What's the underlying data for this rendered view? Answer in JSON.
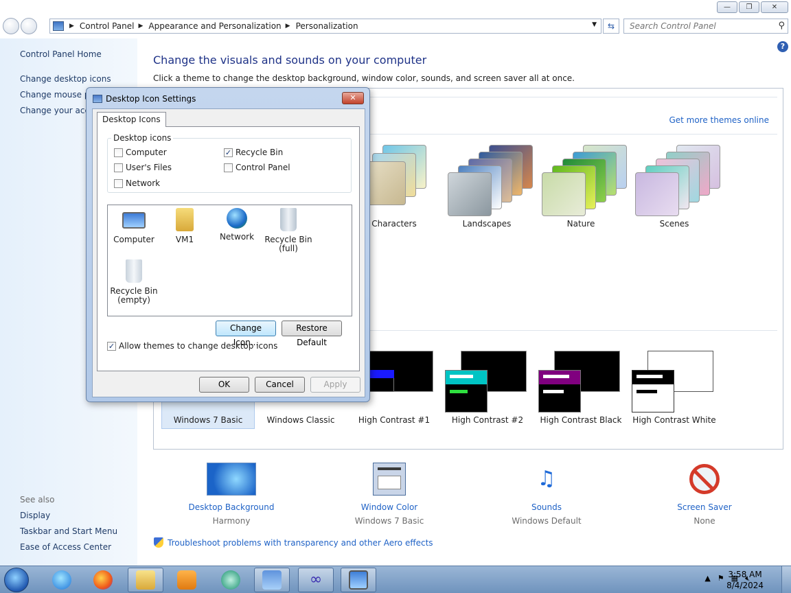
{
  "window": {
    "minimize": "—",
    "restore": "❐",
    "close": "✕"
  },
  "address": {
    "crumbs": [
      "Control Panel",
      "Appearance and Personalization",
      "Personalization"
    ],
    "search_placeholder": "Search Control Panel"
  },
  "leftnav": {
    "home": "Control Panel Home",
    "links": [
      "Change desktop icons",
      "Change mouse po",
      "Change your acco"
    ],
    "see_also": "See also",
    "see_also_links": [
      "Display",
      "Taskbar and Start Menu",
      "Ease of Access Center"
    ]
  },
  "main": {
    "title": "Change the visuals and sounds on your computer",
    "subtitle": "Click a theme to change the desktop background, window color, sounds, and screen saver all at once.",
    "get_more": "Get more themes online",
    "aero_themes": [
      "Characters",
      "Landscapes",
      "Nature",
      "Scenes"
    ],
    "basic_themes": [
      "Windows 7 Basic",
      "Windows Classic",
      "High Contrast #1",
      "High Contrast #2",
      "High Contrast Black",
      "High Contrast White"
    ],
    "bottom": [
      {
        "link": "Desktop Background",
        "value": "Harmony"
      },
      {
        "link": "Window Color",
        "value": "Windows 7 Basic"
      },
      {
        "link": "Sounds",
        "value": "Windows Default"
      },
      {
        "link": "Screen Saver",
        "value": "None"
      }
    ],
    "troubleshoot": "Troubleshoot problems with transparency and other Aero effects"
  },
  "dialog": {
    "title": "Desktop Icon Settings",
    "close": "✕",
    "tab": "Desktop Icons",
    "group_label": "Desktop icons",
    "checkboxes": [
      {
        "label": "Computer",
        "checked": false
      },
      {
        "label": "Recycle Bin",
        "checked": true
      },
      {
        "label": "User's Files",
        "checked": false
      },
      {
        "label": "Control Panel",
        "checked": false
      },
      {
        "label": "Network",
        "checked": false
      }
    ],
    "icons": [
      {
        "label": "Computer"
      },
      {
        "label": "VM1"
      },
      {
        "label": "Network"
      },
      {
        "label": "Recycle Bin (full)"
      },
      {
        "label": "Recycle Bin (empty)"
      }
    ],
    "change_icon": "Change Icon...",
    "restore_default": "Restore Default",
    "allow_themes": "Allow themes to change desktop icons",
    "allow_themes_checked": true,
    "ok": "OK",
    "cancel": "Cancel",
    "apply": "Apply"
  },
  "taskbar": {
    "time": "3:58 AM",
    "date": "8/4/2024",
    "tray_arrow": "▲",
    "apps": [
      "internet-explorer",
      "firefox",
      "file-explorer",
      "media-player",
      "app-circle",
      "control-panel",
      "infinity-app",
      "desktop-app"
    ]
  },
  "colors": {
    "link": "#1f62c6",
    "title": "#1e3287",
    "nav_bg": "#e5f0fb",
    "taskbar": "#7f9fc7"
  }
}
